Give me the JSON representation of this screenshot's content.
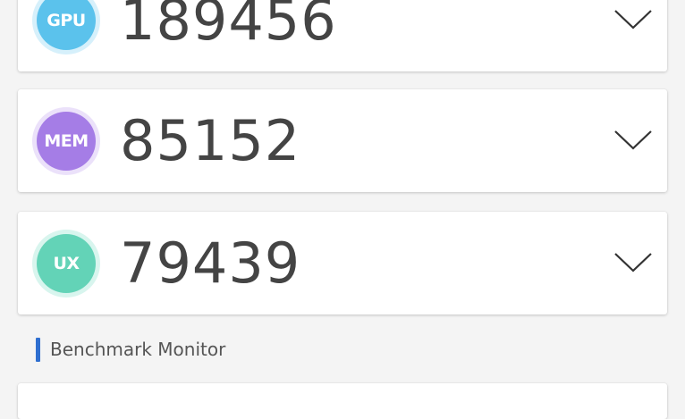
{
  "cards": [
    {
      "badge": "GPU",
      "score": "189456",
      "color": "#5bc2ec",
      "ring": "#d6f0fb"
    },
    {
      "badge": "MEM",
      "score": "85152",
      "color": "#a57de6",
      "ring": "#ebe1fa"
    },
    {
      "badge": "UX",
      "score": "79439",
      "color": "#63d3b7",
      "ring": "#d8f5ee"
    }
  ],
  "section": {
    "title": "Benchmark Monitor",
    "accent_color": "#2f6fd0"
  },
  "icons": {
    "expand": "chevron-down-icon"
  }
}
